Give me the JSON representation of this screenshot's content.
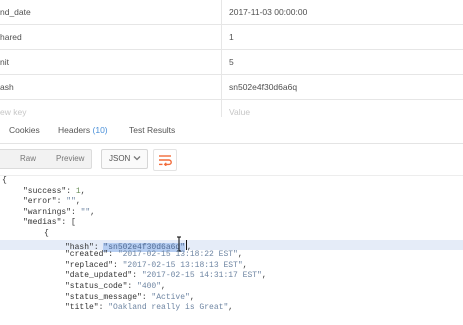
{
  "params": {
    "rows": [
      {
        "key": "nd_date",
        "value": "2017-11-03 00:00:00"
      },
      {
        "key": "hared",
        "value": "1"
      },
      {
        "key": "nit",
        "value": "5"
      },
      {
        "key": "ash",
        "value": "sn502e4f30d6a6q"
      }
    ],
    "new_key_placeholder": "ew key",
    "new_value_placeholder": "Value"
  },
  "tabs": {
    "cookies": "Cookies",
    "headers": "Headers",
    "headers_count": "(10)",
    "tests": "Test Results"
  },
  "toolbar": {
    "pretty_partial": "",
    "raw": "Raw",
    "preview": "Preview",
    "format": "JSON",
    "wrap_icon": "wrap-lines-icon",
    "accent": "#f26b3a"
  },
  "response": {
    "l1": "{",
    "l2_key": "\"success\"",
    "l2_val": "1",
    "l3_key": "\"error\"",
    "l3_val": "\"\"",
    "l4_key": "\"warnings\"",
    "l4_val": "\"\"",
    "l5_key": "\"medias\"",
    "l5_tail": ": [",
    "l6": "{",
    "hash_key": "\"hash\"",
    "hash_val": "\"sn502e4f30d6a6q\"",
    "created_key": "\"created\"",
    "created_val": "\"2017-02-15 13:18:22 EST\"",
    "replaced_key": "\"replaced\"",
    "replaced_val": "\"2017-02-15 13:18:13 EST\"",
    "updated_key": "\"date_updated\"",
    "updated_val": "\"2017-02-15 14:31:17 EST\"",
    "status_code_key": "\"status_code\"",
    "status_code_val": "\"400\"",
    "status_message_key": "\"status_message\"",
    "status_message_val": "\"Active\"",
    "title_key": "\"title\"",
    "title_val": "\"Oakland really is Great\""
  }
}
